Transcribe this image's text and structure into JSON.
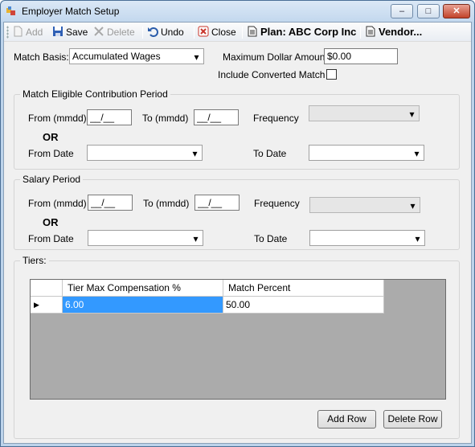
{
  "window": {
    "title": "Employer Match Setup",
    "buttons": {
      "minimize": "–",
      "maximize": "□",
      "close": "✕"
    }
  },
  "toolbar": {
    "add": "Add",
    "save": "Save",
    "delete": "Delete",
    "undo": "Undo",
    "close": "Close",
    "plan": "Plan: ABC Corp Inc",
    "vendor": "Vendor..."
  },
  "form": {
    "match_basis_label": "Match Basis:",
    "match_basis_value": "Accumulated Wages",
    "max_dollar_label": "Maximum Dollar Amount:",
    "max_dollar_value": "$0.00",
    "include_converted_label": "Include Converted Match"
  },
  "match_period": {
    "title": "Match Eligible Contribution Period",
    "from_mmdd_label": "From (mmdd)",
    "from_mmdd_value": "__/__",
    "to_mmdd_label": "To (mmdd)",
    "to_mmdd_value": "__/__",
    "frequency_label": "Frequency",
    "or_label": "OR",
    "from_date_label": "From Date",
    "to_date_label": "To Date"
  },
  "salary_period": {
    "title": "Salary Period",
    "from_mmdd_label": "From (mmdd)",
    "from_mmdd_value": "__/__",
    "to_mmdd_label": "To (mmdd)",
    "to_mmdd_value": "__/__",
    "frequency_label": "Frequency",
    "or_label": "OR",
    "from_date_label": "From Date",
    "to_date_label": "To Date"
  },
  "tiers": {
    "title": "Tiers:",
    "columns": [
      "Tier Max Compensation %",
      "Match Percent"
    ],
    "rows": [
      {
        "tier_max": "6.00",
        "match_percent": "50.00"
      }
    ],
    "add_row": "Add Row",
    "delete_row": "Delete Row"
  },
  "icons": {
    "dropdown": "▾",
    "row_selector": "▶"
  }
}
